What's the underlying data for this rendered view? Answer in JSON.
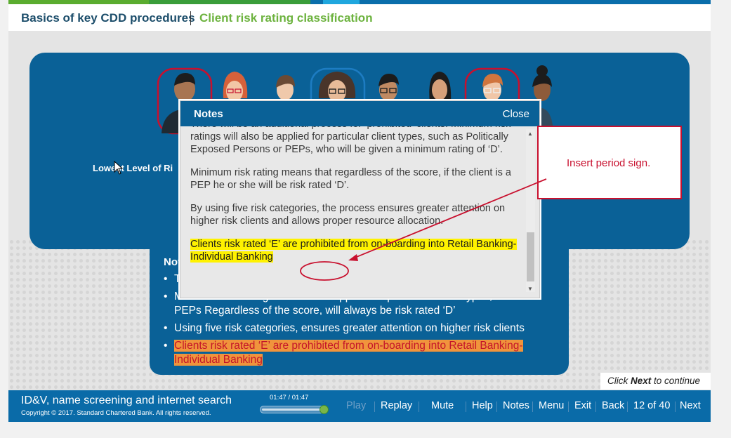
{
  "header": {
    "breadcrumb_course": "Basics of key CDD procedures",
    "breadcrumb_topic": "Client risk rating classification"
  },
  "panel": {
    "lowest_label": "Lowest Level of Ri"
  },
  "notes_box": {
    "title": "Not",
    "bullets": [
      "T",
      "Minimum risk ratings will also be applied for particular client types, such as PEPs Regardless of the score, will always be risk rated ‘D’",
      "Using five risk categories, ensures greater attention on higher risk clients",
      "Clients risk rated ‘E’ are prohibited from on-boarding into Retail Banking-Individual Banking"
    ]
  },
  "dialog": {
    "title": "Notes",
    "close_label": "Close",
    "p0": "There will be an additional process for ‘prohibited’ clients. Minimum risk ratings will also be applied for particular client types, such as Politically Exposed Persons or PEPs, who will be given a minimum rating of ‘D’.",
    "p1": "Minimum risk rating means that regardless of the score, if the client is a PEP he or she will be risk rated ‘D’.",
    "p2": "By using five risk categories, the process ensures greater attention on higher risk clients and allows proper resource allocation.",
    "p3": "Clients risk rated ‘E’ are prohibited from on-boarding into Retail Banking-Individual Banking"
  },
  "callout": {
    "text": "Insert period sign."
  },
  "hint": {
    "pre": "Click ",
    "bold": "Next",
    "post": " to continue"
  },
  "footer": {
    "course_title": "ID&V, name screening and internet search",
    "copyright": "Copyright © 2017. Standard Chartered Bank. All rights reserved.",
    "time": "01:47 / 01:47",
    "progress": 1.0,
    "nav": {
      "play": "Play",
      "replay": "Replay",
      "mute": "Mute",
      "help": "Help",
      "notes": "Notes",
      "menu": "Menu",
      "exit": "Exit",
      "back": "Back",
      "page": "12 of 40",
      "next": "Next"
    }
  },
  "colors": {
    "brand_blue": "#0a6197",
    "brand_green": "#6db33f",
    "annotation_red": "#c8102e",
    "highlight_yellow": "#fff200",
    "highlight_orange": "#f0943c"
  }
}
